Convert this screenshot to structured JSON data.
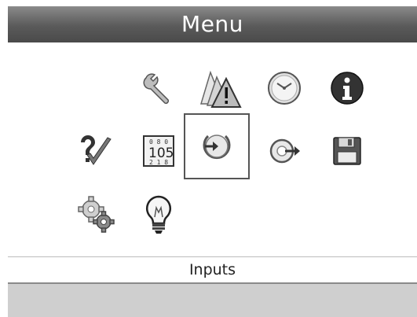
{
  "header": {
    "title": "Menu"
  },
  "status": {
    "selected_label": "Inputs"
  },
  "icons": [
    "wrench-icon",
    "warning-triangles-icon",
    "clock-icon",
    "info-icon",
    "help-check-icon",
    "display-numbers-icon",
    "inputs-icon",
    "outputs-icon",
    "save-icon",
    "settings-gears-icon",
    "lightbulb-icon"
  ],
  "colors": {
    "titlebar": "#5a5a5a",
    "selection_border": "#555555",
    "footer": "#cfcfcf"
  }
}
